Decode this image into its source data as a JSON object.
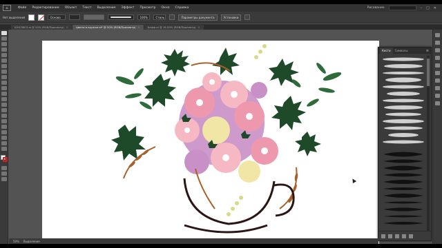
{
  "menubar": {
    "items": [
      "Файл",
      "Редактирование",
      "Объект",
      "Текст",
      "Выделение",
      "Эффект",
      "Просмотр",
      "Окно",
      "Справка"
    ],
    "workspace": "Рисование"
  },
  "control": {
    "label_selection": "Нет выделения",
    "field_profile": "Основа",
    "label_stroke": "",
    "field_opacity": "100%",
    "field_style": "Стиль",
    "button_doc_settings": "Параметры документа",
    "button_prefs": "Установки"
  },
  "tabs": [
    {
      "label": "ЮНС5803.ai @ 50% (RGB/Просмотр)"
    },
    {
      "label": "Цветы в кружке.ai* @ 50% (RGB/Просмотр)"
    },
    {
      "label": "Бафф.ai @ 16.59% (RGB/Просмотр)"
    }
  ],
  "panel": {
    "tab_brushes": "Кисти",
    "tab_symbols": "Символы",
    "menu": "≡"
  },
  "status": {
    "zoom": "50%",
    "tool": "Выделение"
  },
  "colors": {
    "pink_light": "#f6b9c4",
    "pink": "#ee98ae",
    "lilac": "#c98fc7",
    "cream": "#f2e6a6",
    "dark_green": "#1e4a2a",
    "leaf_green": "#2f6b3a",
    "brown": "#a8612a",
    "cup_dark": "#2b1616"
  }
}
